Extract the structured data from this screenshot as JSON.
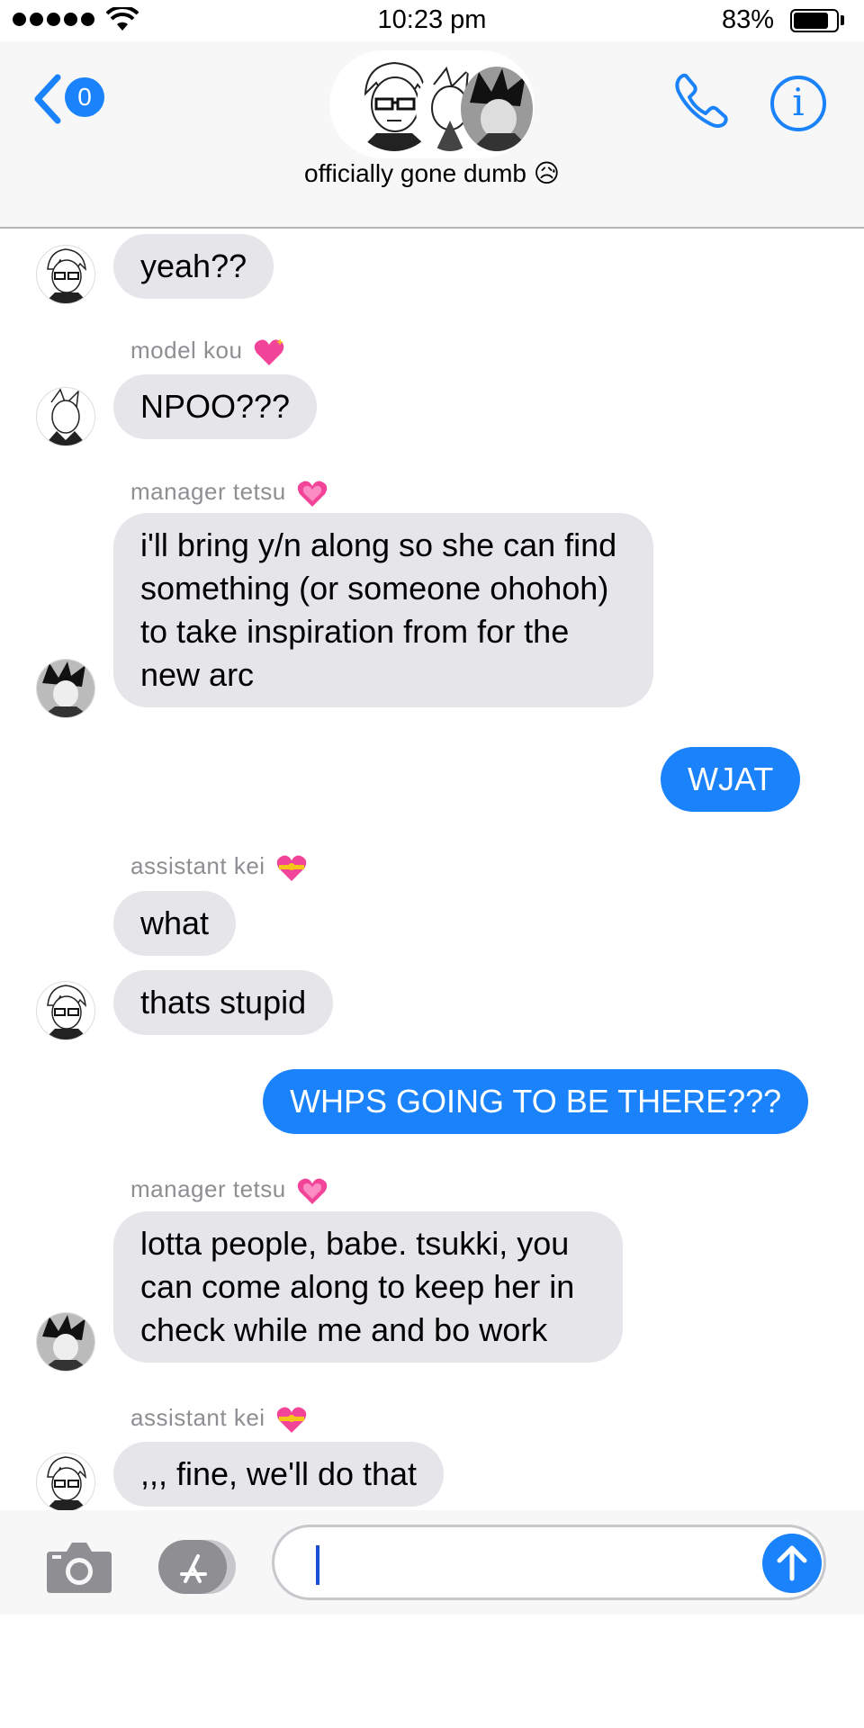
{
  "status_bar": {
    "time": "10:23 pm",
    "battery_percent": "83%",
    "battery_level": 0.83,
    "signal_dots": 5
  },
  "header": {
    "back_badge_count": "0",
    "group_title": "officially gone dumb 😥"
  },
  "messages": [
    {
      "id": "m1",
      "direction": "incoming",
      "sender_label": "",
      "text": "yeah??"
    },
    {
      "id": "m2",
      "direction": "incoming",
      "sender_label": "model kou",
      "text": "NPOO???"
    },
    {
      "id": "m3",
      "direction": "incoming",
      "sender_label": "manager tetsu",
      "text": "i'll bring y/n along so she can find something (or someone ohohoh) to take inspiration from for the new arc"
    },
    {
      "id": "m4",
      "direction": "outgoing",
      "sender_label": "",
      "text": "WJAT"
    },
    {
      "id": "m5",
      "direction": "incoming",
      "sender_label": "assistant kei",
      "text": "what"
    },
    {
      "id": "m6",
      "direction": "incoming",
      "sender_label": "",
      "text": "thats stupid"
    },
    {
      "id": "m7",
      "direction": "outgoing",
      "sender_label": "",
      "text": "WHPS GOING TO BE THERE???"
    },
    {
      "id": "m8",
      "direction": "incoming",
      "sender_label": "manager tetsu",
      "text": "lotta people, babe. tsukki, you can come along to keep her in check while me and bo work"
    },
    {
      "id": "m9",
      "direction": "incoming",
      "sender_label": "assistant kei",
      "text": ",,, fine, we'll do that"
    }
  ],
  "colors": {
    "accent": "#1a82fb",
    "incoming_bubble": "#e5e5ea",
    "sender_label": "#8e8e93",
    "heart_pink": "#f2459a",
    "heart_gold": "#f5c518"
  },
  "icons": {
    "back": "chevron-left-icon",
    "call": "phone-icon",
    "info": "info-icon",
    "camera": "camera-icon",
    "app_store": "app-store-icon",
    "send": "arrow-up-icon"
  },
  "input": {
    "value": ""
  }
}
